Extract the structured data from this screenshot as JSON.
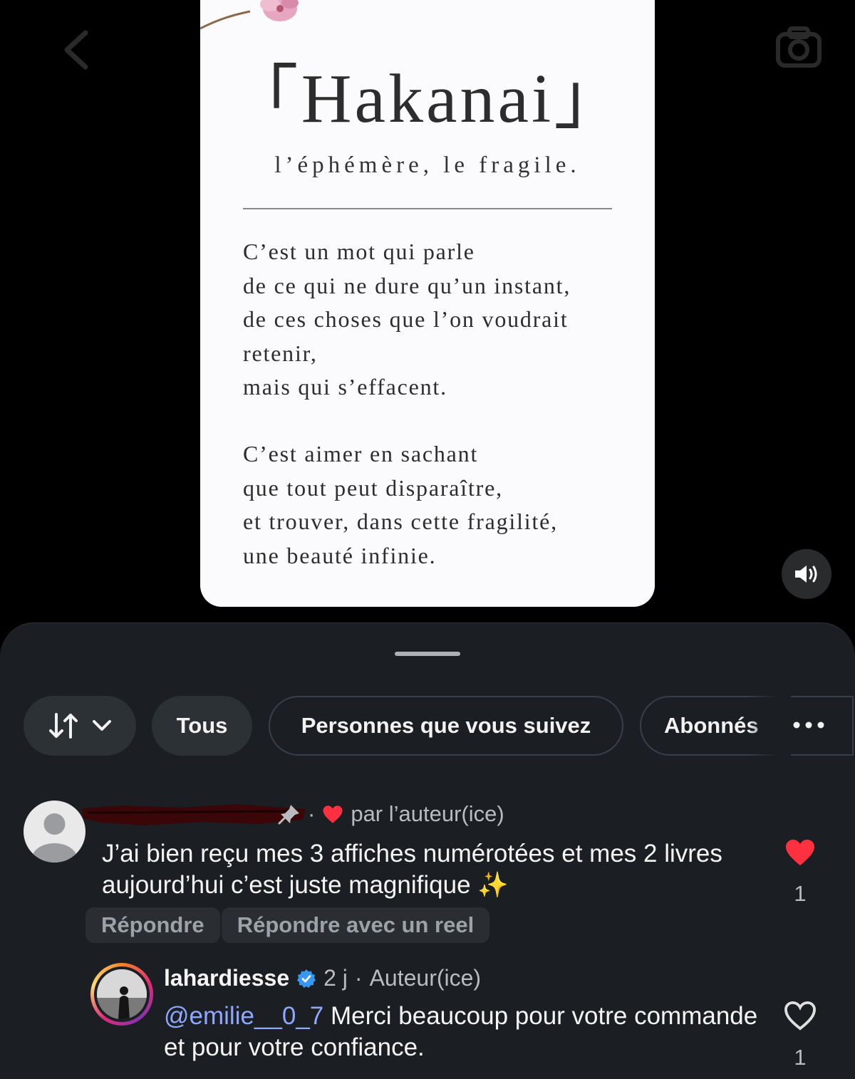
{
  "poster": {
    "title": "「Hakanai」",
    "subtitle": "l’éphémère, le fragile.",
    "stanza1": [
      "C’est un mot qui parle",
      "de ce qui ne dure qu’un instant,",
      "de ces choses que l’on voudrait",
      "retenir,",
      "mais qui s’effacent."
    ],
    "stanza2": [
      "C’est aimer en sachant",
      "que tout peut disparaître,",
      "et trouver, dans cette fragilité,",
      "une beauté infinie."
    ]
  },
  "filters": {
    "tous": "Tous",
    "following": "Personnes que vous suivez",
    "abonnes": "Abonnés"
  },
  "comment": {
    "separator": "·",
    "liked_by": "par l’auteur(ice)",
    "text": "J’ai bien reçu mes 3 affiches numérotées et mes 2 livres aujourd’hui c’est juste magnifique ✨",
    "reply_label": "Répondre",
    "reply_reel_label": "Répondre avec un reel",
    "like_count": "1"
  },
  "reply": {
    "username": "lahardiesse",
    "time": "2 j",
    "separator": "·",
    "author_label": "Auteur(ice)",
    "mention": "@emilie__0_7",
    "text": " Merci beaucoup pour votre commande et pour votre confiance.",
    "like_count": "1"
  },
  "colors": {
    "sheet_bg": "#1b1e22",
    "like_red": "#ff3040",
    "mention_blue": "#8fa8ff",
    "verified_blue": "#3897f0"
  }
}
